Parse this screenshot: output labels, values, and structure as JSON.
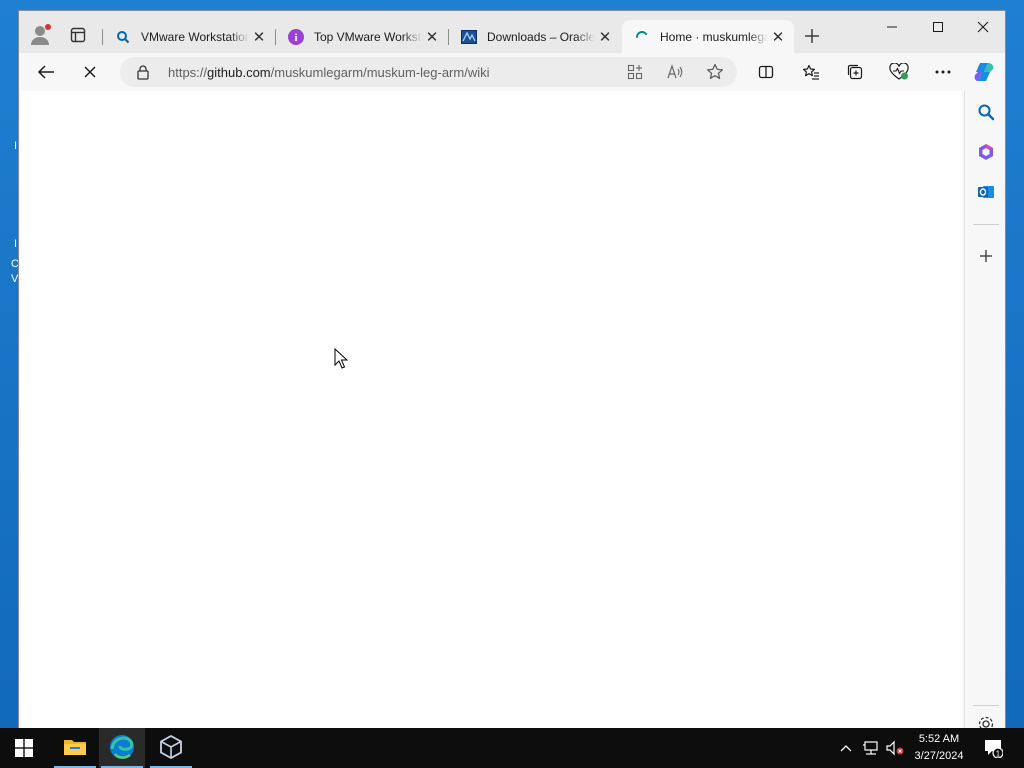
{
  "colors": {
    "accent": "#0078d4",
    "desktop": "#1f7fd0",
    "taskbar": "#0d0d0d",
    "browser_chrome": "#f7f7f7"
  },
  "desktop": {
    "fragments": [
      "I",
      "I",
      "C",
      "V"
    ]
  },
  "browser": {
    "tabs": [
      {
        "title": "VMware Workstation",
        "icon": "search-favicon",
        "active": false
      },
      {
        "title": "Top VMware Workstation",
        "icon": "info-favicon",
        "active": false
      },
      {
        "title": "Downloads – Oracle",
        "icon": "virtualbox-favicon",
        "active": false
      },
      {
        "title": "Home · muskumlegarm",
        "icon": "loading-spinner-icon",
        "active": true
      }
    ],
    "address": {
      "protocol": "https://",
      "host": "github.com",
      "path": "/muskumlegarm/muskum-leg-arm/wiki"
    },
    "page_state": "loading"
  },
  "taskbar": {
    "apps": [
      "file-explorer-icon",
      "edge-icon",
      "virtualbox-icon"
    ],
    "clock": {
      "time": "5:52 AM",
      "date": "3/27/2024"
    },
    "notification_count": "1"
  }
}
